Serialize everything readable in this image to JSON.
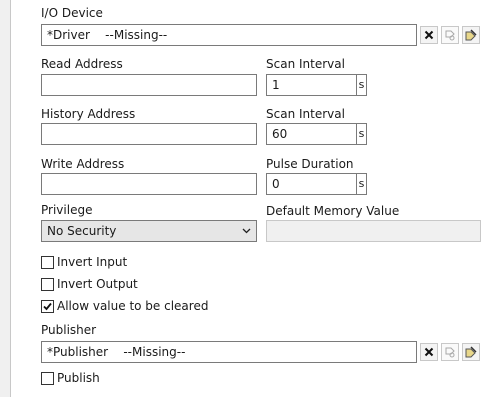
{
  "io_device": {
    "label": "I/O Device",
    "value": "*Driver    --Missing--"
  },
  "read_address": {
    "label": "Read Address",
    "value": ""
  },
  "scan_interval_1": {
    "label": "Scan Interval",
    "value": "1",
    "unit": "s"
  },
  "history_address": {
    "label": "History Address",
    "value": ""
  },
  "scan_interval_2": {
    "label": "Scan Interval",
    "value": "60",
    "unit": "s"
  },
  "write_address": {
    "label": "Write Address",
    "value": ""
  },
  "pulse_duration": {
    "label": "Pulse Duration",
    "value": "0",
    "unit": "s"
  },
  "privilege": {
    "label": "Privilege",
    "selected": "No Security"
  },
  "default_memory_value": {
    "label": "Default Memory Value",
    "value": ""
  },
  "options": {
    "invert_input": {
      "label": "Invert Input",
      "checked": false
    },
    "invert_output": {
      "label": "Invert Output",
      "checked": false
    },
    "allow_clear": {
      "label": "Allow value to be cleared",
      "checked": true
    }
  },
  "publisher": {
    "label": "Publisher",
    "value": "*Publisher    --Missing--"
  },
  "publish": {
    "label": "Publish",
    "checked": false
  },
  "icons": {
    "clear": "close-icon",
    "browse": "tag-browse-icon",
    "edit": "tag-edit-icon"
  },
  "colors": {
    "border": "#7a7a7a",
    "disabled_bg": "#f0f0f0",
    "select_bg": "#e6e6e6"
  }
}
